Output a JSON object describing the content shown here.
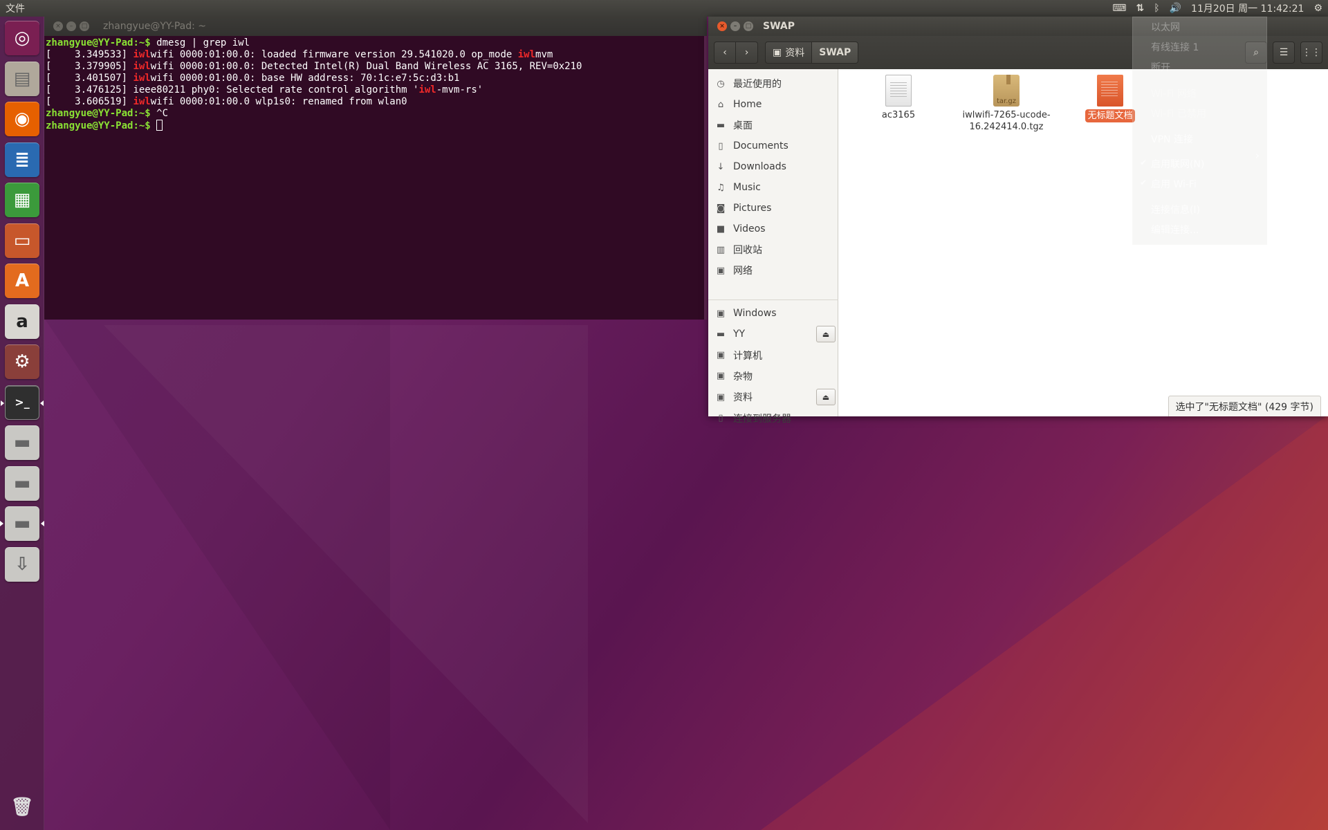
{
  "top_panel": {
    "app_menu": "文件",
    "datetime": "11月20日 周一 11:42:21"
  },
  "launcher": {
    "items": [
      {
        "name": "dash-home",
        "glyph": "◎",
        "color": "#7a1f52"
      },
      {
        "name": "files",
        "glyph": "▤",
        "color": "#b0a89b"
      },
      {
        "name": "firefox",
        "glyph": "◉",
        "color": "#e66000"
      },
      {
        "name": "writer",
        "glyph": "≣",
        "color": "#2a6ab1"
      },
      {
        "name": "calc",
        "glyph": "▦",
        "color": "#3b9a3b"
      },
      {
        "name": "impress",
        "glyph": "▭",
        "color": "#c7572b"
      },
      {
        "name": "software-center",
        "glyph": "A",
        "color": "#e36b1e"
      },
      {
        "name": "amazon",
        "glyph": "a",
        "color": "#d8d6d1"
      },
      {
        "name": "settings",
        "glyph": "⚙",
        "color": "#8a3f3a"
      },
      {
        "name": "terminal",
        "glyph": ">_",
        "color": "#2f2f2f"
      },
      {
        "name": "drive-1",
        "glyph": "▬",
        "color": "#c9c8c4"
      },
      {
        "name": "drive-2",
        "glyph": "▬",
        "color": "#c9c8c4"
      },
      {
        "name": "drive-3",
        "glyph": "▬",
        "color": "#c9c8c4"
      },
      {
        "name": "usb-drive",
        "glyph": "⇩",
        "color": "#c9c8c4"
      }
    ],
    "trash_glyph": "🗑"
  },
  "terminal": {
    "title": "zhangyue@YY-Pad: ~",
    "prompt_user": "zhangyue@YY-Pad",
    "prompt_tail": ":~$ ",
    "command": "dmesg | grep iwl",
    "lines": [
      {
        "ts": "[    3.349533] ",
        "a": "iwl",
        "b": "wifi 0000:01:00.0: loaded firmware version 29.541020.0 op_mode ",
        "c": "iwl",
        "d": "mvm"
      },
      {
        "ts": "[    3.379905] ",
        "a": "iwl",
        "b": "wifi 0000:01:00.0: Detected Intel(R) Dual Band Wireless AC 3165, REV=0x210",
        "c": "",
        "d": ""
      },
      {
        "ts": "[    3.401507] ",
        "a": "iwl",
        "b": "wifi 0000:01:00.0: base HW address: 70:1c:e7:5c:d3:b1",
        "c": "",
        "d": ""
      },
      {
        "ts": "[    3.476125] ",
        "a": "",
        "b": "ieee80211 phy0: Selected rate control algorithm '",
        "c": "iwl",
        "d": "-mvm-rs'"
      },
      {
        "ts": "[    3.606519] ",
        "a": "iwl",
        "b": "wifi 0000:01:00.0 wlp1s0: renamed from wlan0",
        "c": "",
        "d": ""
      }
    ],
    "interrupt": "^C"
  },
  "files": {
    "title": "SWAP",
    "breadcrumbs": [
      "资料",
      "SWAP"
    ],
    "sidebar": [
      {
        "label": "最近使用的",
        "icon": "◷"
      },
      {
        "label": "Home",
        "icon": "⌂"
      },
      {
        "label": "桌面",
        "icon": "▬"
      },
      {
        "label": "Documents",
        "icon": "▯"
      },
      {
        "label": "Downloads",
        "icon": "↓"
      },
      {
        "label": "Music",
        "icon": "♫"
      },
      {
        "label": "Pictures",
        "icon": "◙"
      },
      {
        "label": "Videos",
        "icon": "■"
      },
      {
        "label": "回收站",
        "icon": "▥"
      },
      {
        "label": "网络",
        "icon": "▣"
      }
    ],
    "devices": [
      {
        "label": "Windows",
        "icon": "▣",
        "eject": false
      },
      {
        "label": "YY",
        "icon": "▬",
        "eject": true
      },
      {
        "label": "计算机",
        "icon": "▣",
        "eject": false
      },
      {
        "label": "杂物",
        "icon": "▣",
        "eject": false
      },
      {
        "label": "资料",
        "icon": "▣",
        "eject": true
      },
      {
        "label": "连接到服务器",
        "icon": "▯",
        "eject": false
      }
    ],
    "eject_glyph": "⏏",
    "items": [
      {
        "name_line1": "ac3165",
        "name_line2": "",
        "kind": "doc"
      },
      {
        "name_line1": "iwlwifi-7265-ucode-",
        "name_line2": "16.242414.0.tgz",
        "kind": "pkg",
        "badge": "tar.gz"
      },
      {
        "name_line1": "无标题文档",
        "name_line2": "",
        "kind": "selected"
      }
    ],
    "status": "选中了\"无标题文档\" (429 字节)"
  },
  "network_menu": {
    "ethernet_header": "以太网",
    "wired_connection": "有线连接 1",
    "disconnect": "断开",
    "wifi_header": "Wi-Fi 网络",
    "wifi_disabled": "Wi-Fi 已禁用",
    "vpn": "VPN 连接",
    "enable_networking": "启用联网(N)",
    "enable_wifi": "启用 Wi-Fi",
    "connection_info": "连接信息(I)",
    "edit_connections": "编辑连接..."
  },
  "colors": {
    "terminal_bg": "#300a24",
    "prompt_green": "#8ae234",
    "grep_red": "#ef2929",
    "selection_orange": "#e7673d"
  }
}
